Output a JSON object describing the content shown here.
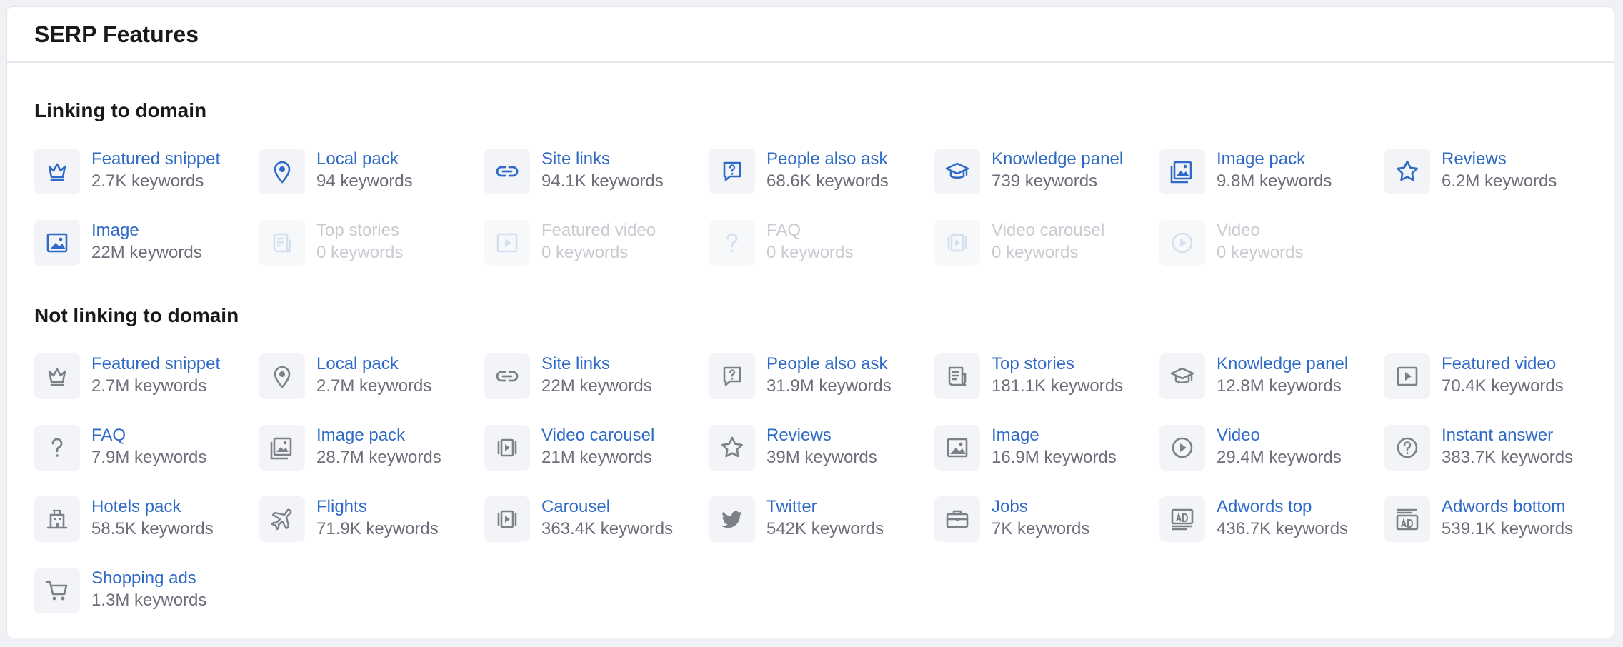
{
  "title": "SERP Features",
  "sections": [
    {
      "title": "Linking to domain",
      "features": [
        {
          "name": "Featured snippet",
          "count": "2.7K keywords",
          "icon": "crown-icon",
          "disabled": false
        },
        {
          "name": "Local pack",
          "count": "94 keywords",
          "icon": "map-pin-icon",
          "disabled": false
        },
        {
          "name": "Site links",
          "count": "94.1K keywords",
          "icon": "link-icon",
          "disabled": false
        },
        {
          "name": "People also ask",
          "count": "68.6K keywords",
          "icon": "question-bubble-icon",
          "disabled": false
        },
        {
          "name": "Knowledge panel",
          "count": "739 keywords",
          "icon": "graduation-cap-icon",
          "disabled": false
        },
        {
          "name": "Image pack",
          "count": "9.8M keywords",
          "icon": "image-pack-icon",
          "disabled": false
        },
        {
          "name": "Reviews",
          "count": "6.2M keywords",
          "icon": "star-icon",
          "disabled": false
        },
        {
          "name": "Image",
          "count": "22M keywords",
          "icon": "image-icon",
          "disabled": false
        },
        {
          "name": "Top stories",
          "count": "0 keywords",
          "icon": "news-icon",
          "disabled": true
        },
        {
          "name": "Featured video",
          "count": "0 keywords",
          "icon": "video-frame-icon",
          "disabled": true
        },
        {
          "name": "FAQ",
          "count": "0 keywords",
          "icon": "question-mark-icon",
          "disabled": true
        },
        {
          "name": "Video carousel",
          "count": "0 keywords",
          "icon": "carousel-icon",
          "disabled": true
        },
        {
          "name": "Video",
          "count": "0 keywords",
          "icon": "play-circle-icon",
          "disabled": true
        }
      ]
    },
    {
      "title": "Not linking to domain",
      "features": [
        {
          "name": "Featured snippet",
          "count": "2.7M keywords",
          "icon": "crown-icon",
          "disabled": false
        },
        {
          "name": "Local pack",
          "count": "2.7M keywords",
          "icon": "map-pin-icon",
          "disabled": false
        },
        {
          "name": "Site links",
          "count": "22M keywords",
          "icon": "link-icon",
          "disabled": false
        },
        {
          "name": "People also ask",
          "count": "31.9M keywords",
          "icon": "question-bubble-icon",
          "disabled": false
        },
        {
          "name": "Top stories",
          "count": "181.1K keywords",
          "icon": "news-icon",
          "disabled": false
        },
        {
          "name": "Knowledge panel",
          "count": "12.8M keywords",
          "icon": "graduation-cap-icon",
          "disabled": false
        },
        {
          "name": "Featured video",
          "count": "70.4K keywords",
          "icon": "video-frame-icon",
          "disabled": false
        },
        {
          "name": "FAQ",
          "count": "7.9M keywords",
          "icon": "question-mark-icon",
          "disabled": false
        },
        {
          "name": "Image pack",
          "count": "28.7M keywords",
          "icon": "image-pack-icon",
          "disabled": false
        },
        {
          "name": "Video carousel",
          "count": "21M keywords",
          "icon": "carousel-icon",
          "disabled": false
        },
        {
          "name": "Reviews",
          "count": "39M keywords",
          "icon": "star-icon",
          "disabled": false
        },
        {
          "name": "Image",
          "count": "16.9M keywords",
          "icon": "image-icon",
          "disabled": false
        },
        {
          "name": "Video",
          "count": "29.4M keywords",
          "icon": "play-circle-icon",
          "disabled": false
        },
        {
          "name": "Instant answer",
          "count": "383.7K keywords",
          "icon": "question-circle-icon",
          "disabled": false
        },
        {
          "name": "Hotels pack",
          "count": "58.5K keywords",
          "icon": "hotel-icon",
          "disabled": false
        },
        {
          "name": "Flights",
          "count": "71.9K keywords",
          "icon": "airplane-icon",
          "disabled": false
        },
        {
          "name": "Carousel",
          "count": "363.4K keywords",
          "icon": "carousel-icon",
          "disabled": false
        },
        {
          "name": "Twitter",
          "count": "542K keywords",
          "icon": "twitter-icon",
          "disabled": false
        },
        {
          "name": "Jobs",
          "count": "7K keywords",
          "icon": "briefcase-icon",
          "disabled": false
        },
        {
          "name": "Adwords top",
          "count": "436.7K keywords",
          "icon": "ad-top-icon",
          "disabled": false
        },
        {
          "name": "Adwords bottom",
          "count": "539.1K keywords",
          "icon": "ad-bottom-icon",
          "disabled": false
        },
        {
          "name": "Shopping ads",
          "count": "1.3M keywords",
          "icon": "shopping-cart-icon",
          "disabled": false
        }
      ]
    }
  ],
  "colors": {
    "link": "#2e6ac6",
    "muted": "#6c6e79",
    "disabled_text": "#c9cbd1",
    "icon_bg": "#f3f4f8"
  }
}
